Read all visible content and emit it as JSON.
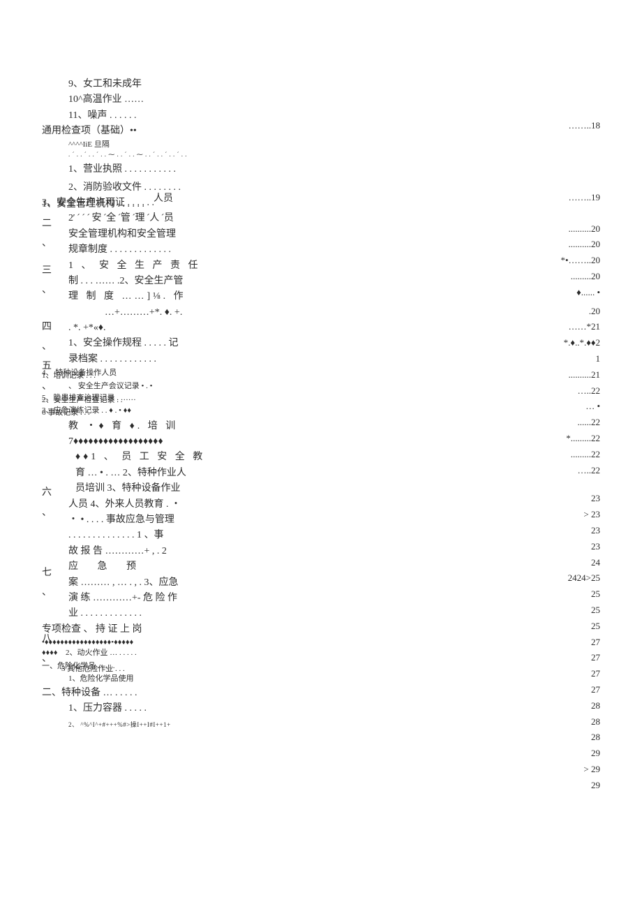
{
  "left": {
    "l01": "9、女工和未成年",
    "l02": "10^高温作业 ……",
    "l03": "11、噪声 . . . .  . .",
    "l04": "通用检查项（基础）••",
    "l05": "^^^^IiE 旦隔",
    "l06": ". ´ . . ´ . . ´ . . ⁓ . . ´ . . ⁓ . . ´ . . ´ . . ´ . .",
    "l07": "1、营业执照 . . . . . . . . . . .",
    "l08": "2、消防验收文件 . . . . . . . .",
    "l08b": "人员",
    "l09a": "3、安全生产许可证 . . . . . .",
    "l09b": "1、安全管理机构 . . . . . .",
    "l10": "2′ ´ ´ ´ 安 ´全 ´管 ´理 ´人 ´员",
    "l11": "安全管理机构和安全管理",
    "l12": "规章制度 . . . . . . . . . . . . .",
    "l13": "1  、 安 全 生 产 责 任",
    "l14": "制 . . . …… .2、安全生产管",
    "l15": "理  制  度  ……]⅛.     作",
    "l16": "…+………+*. ♦. +.",
    "l17": ". *. +*«♦.",
    "l18": "1、安全操作规程 . . . . . 记",
    "l19": "录档案 . . . .  . . . . . . . .",
    "l20a": "4、 特种设备操作人员",
    "l20b": "1、培训记录 . . .",
    "l20c": "、  安全生产会议记录 • . •",
    "l21a": "5、隐患排查治理记录 . ……",
    "l21b": "2、安全生产检查记录 . .",
    "l22a": "3、应急演练记录 . . ♦ . • ♦♦",
    "l22b": "6  事故记录 . . .",
    "l23": "教  ・♦ 育 ♦.   培   训",
    "l24": "7♦♦♦♦♦♦♦♦♦♦♦♦♦♦♦♦♦♦",
    "l25": "♦♦1  、 员 工 安 全 教",
    "l26": "育 … • . … 2、特种作业人",
    "l27": "员培训 3、特种设备作业",
    "l28": "人员 4、外来人员教育 .  ・",
    "l29": "・ • . . . . 事故应急与管理",
    "l30": ". . . . . . . . . . . . . . 1 、事",
    "l31": "故 报 告 …………+ ,   .  2",
    "l32": "应      急      预",
    "l33": "案 ……… , … .  ,  . 3、应急",
    "l34": "演 练 …………+- 危 险 作",
    "l35": "业 . . . . . . . . . . . . .",
    "l36": "专项检查 、  持  证  上  岗",
    "l37": "•♦♦♦♦♦♦♦♦♦♦♦♦♦♦♦♦♦•♦♦♦♦♦",
    "l38": "♦♦♦♦",
    "l38b": "2、动火作业 …  . . . . .",
    "l39a": "一、危险化学品  . . . . .",
    "l39b": "3 其他危险作业 . . .",
    "l40": "1、危险化学品使用",
    "l41": "二、特种设备 …  . . . . .",
    "l42": "1、压力容器 . . . . .",
    "l43": "2、 ^%^I^+#+++%#>操I++I#I++1+"
  },
  "numcol": {
    "n2a": "二",
    "n2b": "、",
    "n3a": "三",
    "n3b": "、",
    "n4a": "四",
    "n4b": "、",
    "n5a": "五",
    "n5b": "、",
    "n6a": "六",
    "n6b": "、",
    "n7a": "七",
    "n7b": "、",
    "n8a": "八",
    "n8b": "、"
  },
  "right": {
    "r01": "……..18",
    "r02": "……..19",
    "r03": "..........20",
    "r04": "..........20",
    "r05": "*•……..20",
    "r06": ".........20",
    "r07": "♦......    •",
    "r08": ".20",
    "r09": "……*21",
    "r10": "*.♦..*.♦♦2",
    "r11": "1",
    "r12": "..........21",
    "r13": "…..22",
    "r14": "…    •",
    "r15": "......22",
    "r16": "*.........22",
    "r17": ".........22",
    "r18": "…..22",
    "r19": "23",
    "r20": ">         23",
    "r21": "23",
    "r22": "23",
    "r23": "24",
    "r24": "2424>25",
    "r25": "25",
    "r26": "25",
    "r27": "25",
    "r28": "27",
    "r29": "27",
    "r30": "27",
    "r31": "27",
    "r32": "28",
    "r33": "28",
    "r34": "28",
    "r35": "29",
    "r36": ">        29",
    "r37": "29"
  }
}
